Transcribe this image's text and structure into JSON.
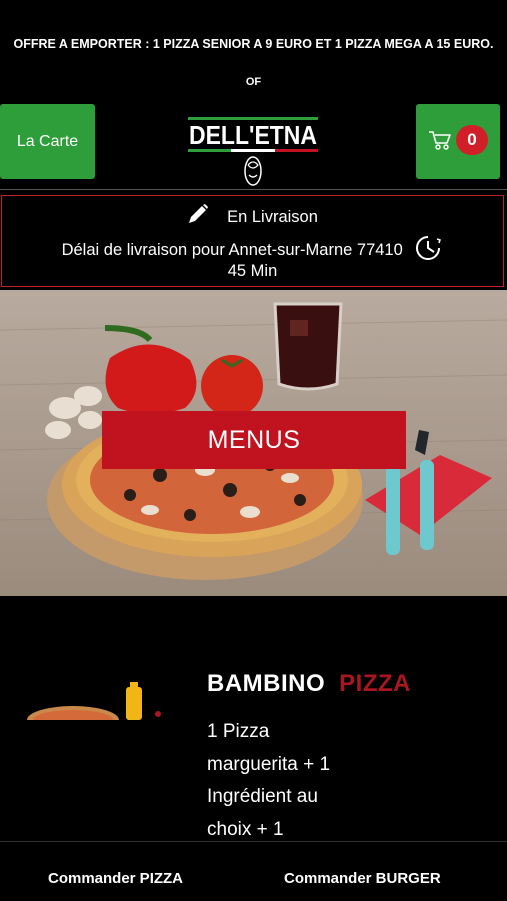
{
  "promo": {
    "line1": "OFFRE A EMPORTER : 1 PIZZA SENIOR A 9 EURO ET 1 PIZZA MEGA A 15 EURO.",
    "line2": "OF"
  },
  "header": {
    "carte_label": "La Carte",
    "logo_text": "DELL'ETNA",
    "cart_count": "0"
  },
  "delivery": {
    "mode": "En Livraison",
    "delay": "Délai de livraison pour Annet-sur-Marne 77410",
    "time": "45 Min"
  },
  "hero": {
    "button_label": "MENUS"
  },
  "product": {
    "name": "BAMBINO",
    "category": "PIZZA",
    "desc_lines": [
      "1 Pizza",
      "marguerita  + 1",
      "Ingrédient au",
      "choix  + 1"
    ]
  },
  "bottom_nav": {
    "pizza_label": "Commander PIZZA",
    "burger_label": "Commander BURGER"
  },
  "colors": {
    "green": "#2e9e3a",
    "red": "#c0131f",
    "dark_red": "#a81721"
  }
}
